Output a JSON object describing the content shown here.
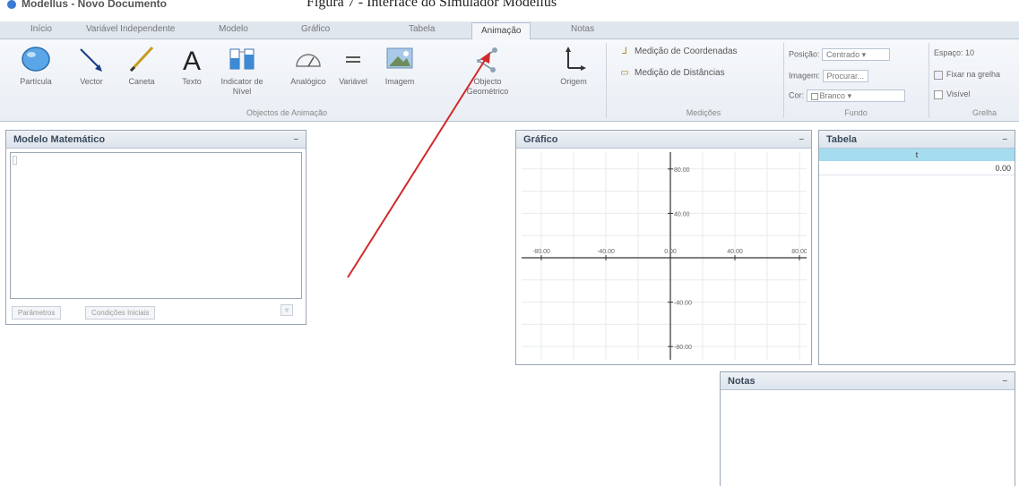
{
  "caption": "Figura 7 - Interface do Simulador Modellus",
  "window_title": "Modellus - Novo Documento",
  "tabs": [
    "Início",
    "Variável Independente",
    "Modelo",
    "Gráfico",
    "Tabela",
    "Animação",
    "Notas"
  ],
  "active_tab": "Animação",
  "ribbon": {
    "tools": [
      {
        "label": "Partícula",
        "icon": "particle-icon"
      },
      {
        "label": "Vector",
        "icon": "vector-icon"
      },
      {
        "label": "Caneta",
        "icon": "pen-icon"
      },
      {
        "label": "Texto",
        "icon": "text-icon"
      },
      {
        "label": "Indicator de Nível",
        "icon": "level-indicator-icon"
      },
      {
        "label": "Analógico",
        "icon": "analog-gauge-icon"
      },
      {
        "label": "Variável",
        "icon": "variable-icon"
      },
      {
        "label": "Imagem",
        "icon": "image-icon"
      },
      {
        "label": "Objecto Geométrico",
        "icon": "geometric-object-icon"
      },
      {
        "label": "Origem",
        "icon": "origin-icon"
      }
    ],
    "group_animation": "Objectos de Animação",
    "measure": {
      "coords": "Medição de Coordenadas",
      "dist": "Medição de Distâncias",
      "group": "Medições"
    },
    "background": {
      "posicao_label": "Posição:",
      "posicao_value": "Centrado",
      "imagem_label": "Imagem:",
      "procurar": "Procurar...",
      "cor_label": "Cor:",
      "cor_value": "Branco",
      "group": "Fundo"
    },
    "grid": {
      "espaco": "Espaço: 10",
      "fixar": "Fixar na grelha",
      "visivel": "Visível",
      "group": "Grelha"
    }
  },
  "model_panel": {
    "title": "Modelo Matemático",
    "btn_params": "Parâmetros",
    "btn_initial": "Condições Iniciais"
  },
  "graph_panel": {
    "title": "Gráfico"
  },
  "table_panel": {
    "title": "Tabela",
    "column": "t",
    "value": "0.00"
  },
  "notes_panel": {
    "title": "Notas"
  },
  "chart_data": {
    "type": "line",
    "x_ticks": [
      "-80.00",
      "-40.00",
      "0.00",
      "40.00",
      "80.00"
    ],
    "y_ticks": [
      "80.00",
      "40.00",
      "-40.00",
      "-80.00"
    ],
    "xlim": [
      -100,
      100
    ],
    "ylim": [
      -100,
      100
    ],
    "grid": true,
    "series": []
  },
  "colors": {
    "arrow": "#d02a2a",
    "table_header": "#a6dcef",
    "tab_bar": "#dfe6ee"
  }
}
